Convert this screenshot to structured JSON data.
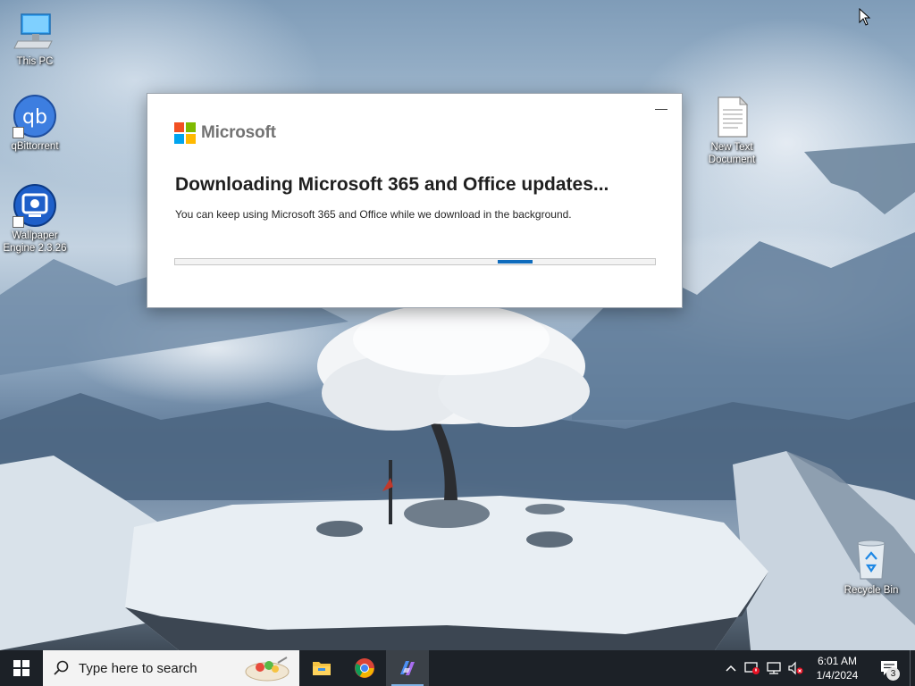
{
  "desktop": {
    "icons": [
      {
        "label": "This PC"
      },
      {
        "label": "qBittorrent"
      },
      {
        "label": "Wallpaper\nEngine 2.3.26"
      },
      {
        "label": "New Text\nDocument"
      },
      {
        "label": "Recycle Bin"
      }
    ]
  },
  "dialog": {
    "brand": "Microsoft",
    "minimize_glyph": "—",
    "title": "Downloading Microsoft 365 and Office updates...",
    "subtitle": "You can keep using Microsoft 365 and Office while we download in the background.",
    "progress": {
      "type": "indeterminate"
    },
    "logo_colors": [
      "#f25022",
      "#7fba00",
      "#00a4ef",
      "#ffb900"
    ]
  },
  "taskbar": {
    "search_placeholder": "Type here to search",
    "apps": [
      {
        "icon": "file-explorer-icon"
      },
      {
        "icon": "chrome-icon"
      },
      {
        "icon": "copilot-icon",
        "active": true
      }
    ],
    "tray": {
      "icons": [
        "chevron-up-icon",
        "security-warning-icon",
        "network-icon",
        "volume-muted-icon"
      ],
      "time": "6:01 AM",
      "date": "1/4/2024",
      "notification_count": "3"
    },
    "accent": "#0078d4"
  }
}
